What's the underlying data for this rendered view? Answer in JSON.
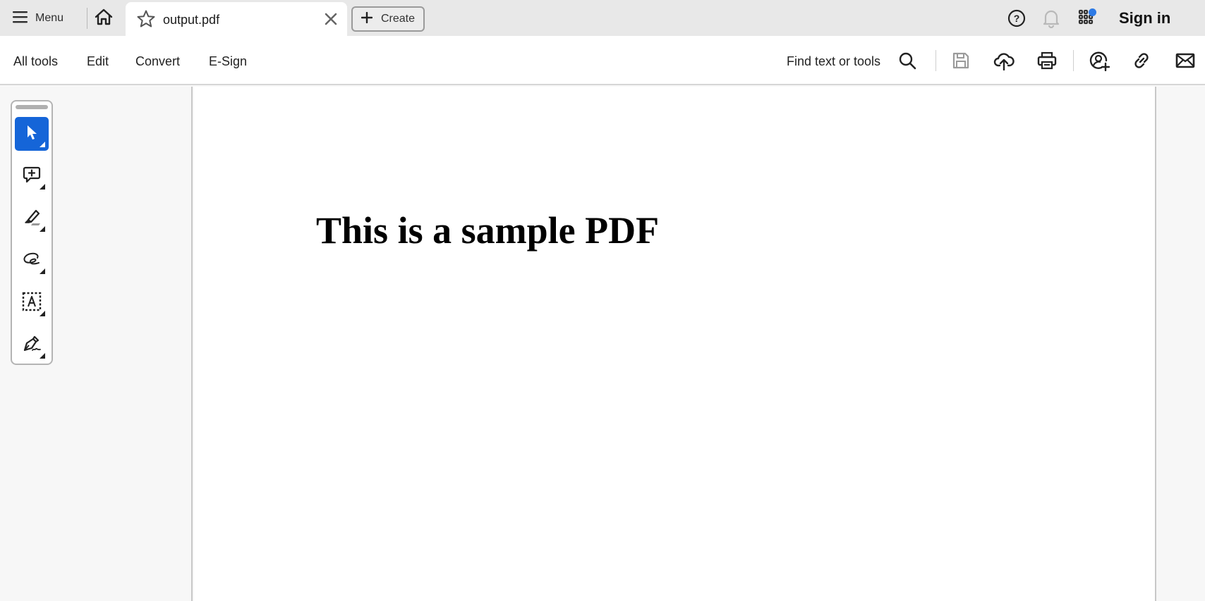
{
  "tabbar": {
    "menu_label": "Menu",
    "menu_icon": "hamburger-icon",
    "home_icon": "home-icon",
    "active_tab": {
      "title": "output.pdf",
      "favorite_icon": "star-icon",
      "close_icon": "close-icon"
    },
    "create_label": "Create",
    "create_icon": "plus-icon",
    "help_icon": "help-icon",
    "notifications_icon": "bell-icon",
    "apps_icon": "apps-grid-icon",
    "apps_badge_color": "#2d7ae5",
    "sign_in_label": "Sign in"
  },
  "toolbar": {
    "nav_items": [
      {
        "label": "All tools"
      },
      {
        "label": "Edit"
      },
      {
        "label": "Convert"
      },
      {
        "label": "E-Sign"
      }
    ],
    "find_label": "Find text or tools",
    "actions": [
      {
        "name": "search",
        "icon": "search-icon"
      },
      {
        "name": "save",
        "icon": "save-icon",
        "disabled": true
      },
      {
        "name": "upload",
        "icon": "cloud-upload-icon"
      },
      {
        "name": "print",
        "icon": "print-icon"
      },
      {
        "name": "share",
        "icon": "add-person-icon"
      },
      {
        "name": "link",
        "icon": "link-icon"
      },
      {
        "name": "email",
        "icon": "email-icon"
      }
    ]
  },
  "quick_tools": {
    "accent_color": "#1565d8",
    "items": [
      {
        "name": "select",
        "icon": "cursor-arrow-icon",
        "active": true
      },
      {
        "name": "add-comment",
        "icon": "comment-plus-icon",
        "active": false
      },
      {
        "name": "highlight",
        "icon": "highlighter-icon",
        "active": false
      },
      {
        "name": "draw",
        "icon": "freehand-draw-icon",
        "active": false
      },
      {
        "name": "add-text",
        "icon": "text-box-icon",
        "active": false
      },
      {
        "name": "sign",
        "icon": "pen-sign-icon",
        "active": false
      }
    ]
  },
  "document": {
    "heading": "This is a sample PDF"
  }
}
